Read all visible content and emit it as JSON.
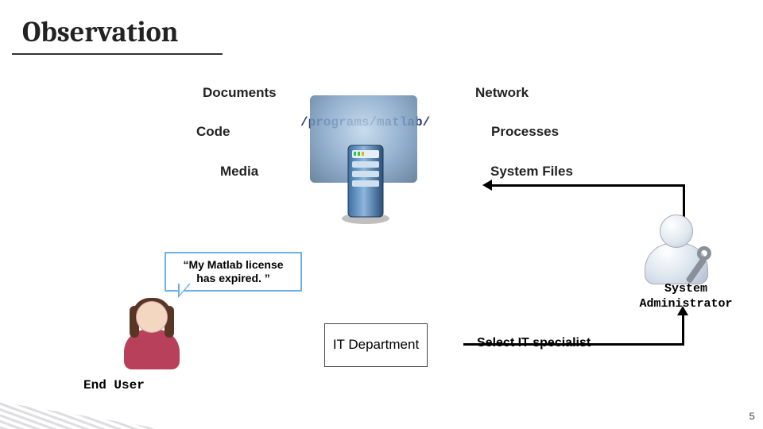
{
  "title": "Observation",
  "labels": {
    "documents": "Documents",
    "code": "Code",
    "media": "Media",
    "network": "Network",
    "processes": "Processes",
    "system_files": "System Files"
  },
  "path": "/programs/matlab/",
  "bubble_text": "“My Matlab license has expired. ”",
  "it_box": "IT Department",
  "select_specialist": "Select IT specialist",
  "end_user": "End User",
  "sys_admin": "System Administrator",
  "page_number": "5"
}
